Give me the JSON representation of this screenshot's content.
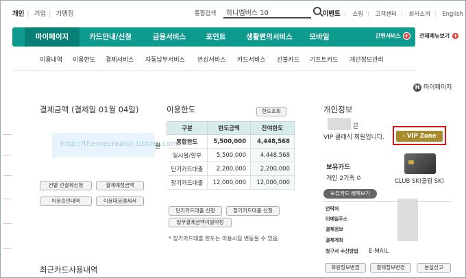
{
  "top_left": {
    "items": [
      "개인",
      "기업",
      "기맹점"
    ],
    "active": "개인"
  },
  "search": {
    "label": "통합검색",
    "value": "하나멤버스 10"
  },
  "top_right": {
    "items": [
      "이벤트",
      "쇼핑",
      "고객센터",
      "회사소개",
      "English"
    ]
  },
  "main_nav": {
    "items": [
      "마이페이지",
      "카드안내/신청",
      "금융서비스",
      "포인트",
      "생활편의서비스",
      "모바일"
    ],
    "util": [
      "간편서비스",
      "전체메뉴보기"
    ]
  },
  "sub_nav": [
    "이용내역",
    "이용한도",
    "결제서비스",
    "자동납부서비스",
    "안심서비스",
    "카드서비스",
    "선불카드",
    "기프트카드",
    "개인정보관리"
  ],
  "my_page_badge": {
    "icon": "H",
    "label": "마이페이지"
  },
  "payment": {
    "title": "결제금액 (결제일 01월 04일)",
    "watermark": "http://themecreator.tistory.com",
    "watermark_tail": "원",
    "buttons": [
      "건별 선결제신청",
      "결제예정금액",
      "이용승인내역",
      "이용대금명세서"
    ]
  },
  "limit": {
    "title": "이용한도",
    "inquiry_button": "한도조회",
    "headers": [
      "구분",
      "한도금액",
      "잔여한도"
    ],
    "rows": [
      [
        "통합한도",
        "5,500,000",
        "4,448,568"
      ],
      [
        "일시불/할부",
        "5,500,000",
        "4,448,568"
      ],
      [
        "단기카드대출",
        "2,200,000",
        "2,200,000"
      ],
      [
        "장기카드대출",
        "12,000,000",
        "12,000,000"
      ]
    ],
    "buttons": [
      "단기카드대출 신청",
      "장기카드대출 신청",
      "일부결제금액이월약정"
    ],
    "note": "* 장기카드대출 한도는 이용시점 변동될 수 있음."
  },
  "recent_title": "최근카드사용내역",
  "personal": {
    "title": "개인정보",
    "name_suffix": "은",
    "grade_text": "VIP 클래식 회원입니다.",
    "vip_button": "› VIP Zone",
    "holding_title": "보유카드",
    "holding_count": "개인 2기족 0",
    "card_name": "CLUB SK(클럽 SK)",
    "benefit_button": "보유카드 혜택보기",
    "info_labels": [
      "연락처",
      "이메일주소",
      "결제정보",
      "결제계좌",
      "청구서 수신방법"
    ],
    "billing_method": "E-MAIL",
    "buttons": [
      "회원정보변경",
      "결제정보변경",
      "분실신고"
    ]
  },
  "colors": {
    "nav_green": "#0f9a8e",
    "vip_gold": "#a88a2c",
    "highlight_red": "#e01010"
  }
}
